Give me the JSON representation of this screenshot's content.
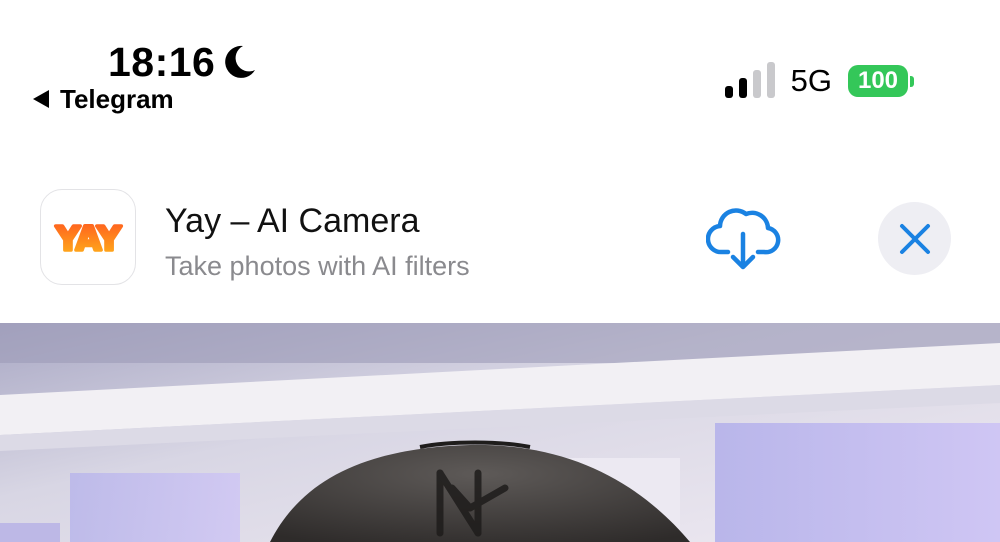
{
  "status_bar": {
    "time": "18:16",
    "focus_icon": "moon-icon",
    "back_app": "Telegram",
    "back_icon": "back-arrow-icon",
    "signal_icon": "cellular-signal-icon",
    "network": "5G",
    "battery_level": "100",
    "battery_color": "#34c759"
  },
  "app_banner": {
    "app_icon": "yay-app-icon",
    "icon_text": "YAY",
    "title": "Yay – AI Camera",
    "subtitle": "Take photos with AI filters",
    "download_icon": "cloud-download-icon",
    "close_icon": "close-icon",
    "accent_color": "#1a82e2"
  },
  "photo": {
    "description_icon": "photo-image"
  }
}
